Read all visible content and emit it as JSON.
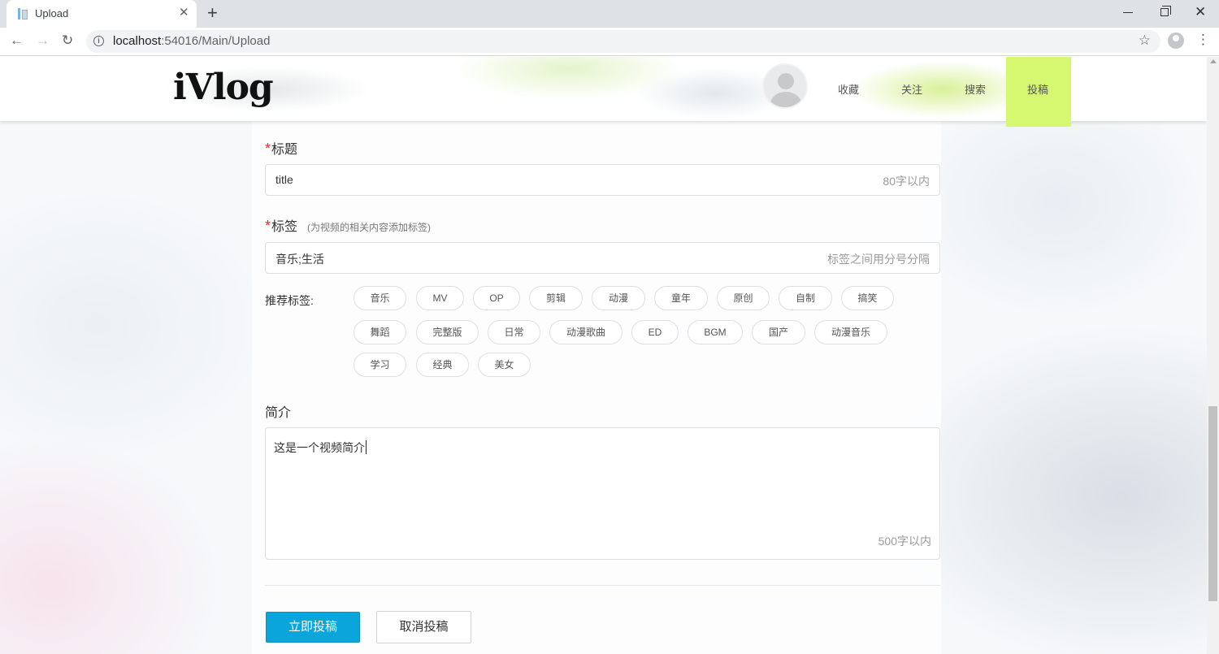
{
  "browser": {
    "tab_title": "Upload",
    "new_tab_symbol": "+",
    "url_host": "localhost",
    "url_path": ":54016/Main/Upload"
  },
  "header": {
    "logo": "iVlog",
    "nav": {
      "favorites": "收藏",
      "follow": "关注",
      "search": "搜索",
      "upload": "投稿"
    },
    "colors": {
      "active_nav_bg": "#d6f871"
    }
  },
  "form": {
    "title": {
      "label": "标题",
      "required_mark": "*",
      "value": "title",
      "hint": "80字以内"
    },
    "tags": {
      "label": "标签",
      "required_mark": "*",
      "note": "(为视频的相关内容添加标签)",
      "value": "音乐;生活",
      "hint": "标签之间用分号分隔"
    },
    "recommended": {
      "label": "推荐标签:",
      "rows": [
        [
          "音乐",
          "MV",
          "OP",
          "剪辑",
          "动漫",
          "童年",
          "原创",
          "自制",
          "搞笑"
        ],
        [
          "舞蹈",
          "完整版",
          "日常",
          "动漫歌曲",
          "ED",
          "BGM",
          "国产",
          "动漫音乐"
        ],
        [
          "学习",
          "经典",
          "美女"
        ]
      ]
    },
    "intro": {
      "label": "简介",
      "value": "这是一个视频简介",
      "hint": "500字以内"
    },
    "buttons": {
      "submit": "立即投稿",
      "cancel": "取消投稿"
    },
    "colors": {
      "submit_bg": "#0aa5db",
      "required": "#e02b2b"
    }
  }
}
